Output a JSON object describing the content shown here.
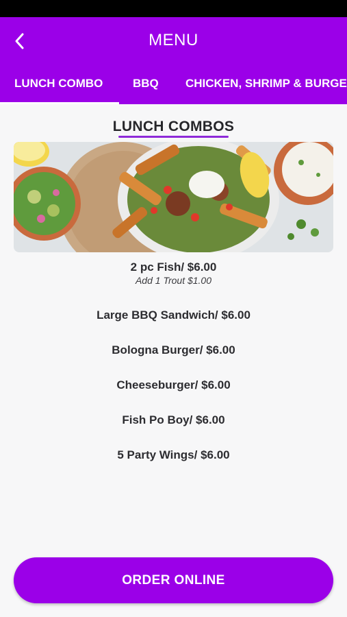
{
  "app_bar": {
    "title": "MENU",
    "back_icon": "chevron-left-icon",
    "color": "#9b00e8"
  },
  "tabs": [
    {
      "label": "LUNCH COMBO",
      "selected": true
    },
    {
      "label": "BBQ",
      "selected": false
    },
    {
      "label": "CHICKEN, SHRIMP & BURGERS",
      "selected": false
    }
  ],
  "section": {
    "title": "LUNCH COMBOS"
  },
  "items": [
    {
      "name": "2 pc Fish/ $6.00",
      "note": "Add 1 Trout $1.00"
    },
    {
      "name": "Large BBQ Sandwich/ $6.00"
    },
    {
      "name": "Bologna Burger/ $6.00"
    },
    {
      "name": "Cheeseburger/ $6.00"
    },
    {
      "name": "Fish Po Boy/ $6.00"
    },
    {
      "name": "5 Party Wings/ $6.00"
    }
  ],
  "order_button": {
    "label": "ORDER ONLINE"
  }
}
